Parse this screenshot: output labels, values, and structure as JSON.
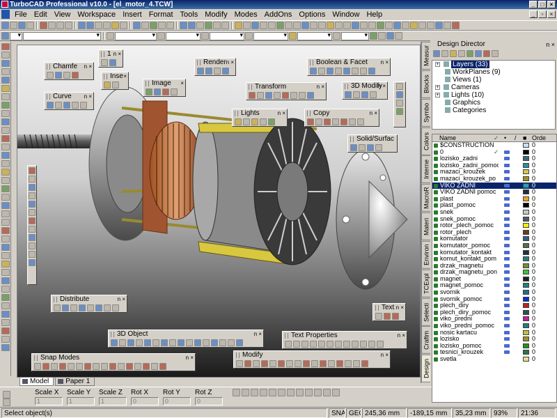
{
  "window": {
    "title": "TurboCAD Professional v10.0 - [el_motor_4.TCW]"
  },
  "menu": [
    "File",
    "Edit",
    "View",
    "Workspace",
    "Insert",
    "Format",
    "Tools",
    "Modify",
    "Modes",
    "AddOns",
    "Options",
    "Window",
    "Help"
  ],
  "palettes": {
    "chamfer": "Chamfe",
    "curve": "Curve",
    "insert": "Inse",
    "image": "Image",
    "render": "Render",
    "boolean": "Boolean & Facet",
    "transform": "Transform",
    "modify3d": "3D Modify",
    "lights": "Lights",
    "copy": "Copy",
    "solid": "Solid/Surfac",
    "distribute": "Distribute",
    "text": "Text",
    "object3d": "3D Object",
    "textprops": "Text Properties",
    "snap": "Snap Modes",
    "modify": "Modify"
  },
  "tabs": [
    "Model",
    "Paper 1"
  ],
  "inputbar": {
    "fields": [
      {
        "label": "Scale X",
        "value": "1"
      },
      {
        "label": "Scale Y",
        "value": "1"
      },
      {
        "label": "Scale Z",
        "value": "1"
      },
      {
        "label": "Rot X",
        "value": "0"
      },
      {
        "label": "Rot Y",
        "value": "0"
      },
      {
        "label": "Rot Z",
        "value": "0"
      }
    ]
  },
  "status": {
    "prompt": "Select object(s)",
    "snap": "SNAP",
    "geo": "GEO",
    "x": "245,36 mm",
    "y": "-189,15 mm",
    "z": "35,23 mm",
    "zoom": "93%",
    "time": "21:36"
  },
  "director": {
    "title": "Design Director",
    "tree": [
      {
        "label": "Layers (33)",
        "selected": true,
        "expandable": true
      },
      {
        "label": "WorkPlanes (9)",
        "selected": false,
        "expandable": false
      },
      {
        "label": "Views (1)",
        "selected": false,
        "expandable": false
      },
      {
        "label": "Cameras",
        "selected": false,
        "expandable": true
      },
      {
        "label": "Lights (10)",
        "selected": false,
        "expandable": true
      },
      {
        "label": "Graphics",
        "selected": false,
        "expandable": false
      },
      {
        "label": "Categories",
        "selected": false,
        "expandable": false
      }
    ],
    "columns": [
      "Name",
      "Orde"
    ],
    "layers": [
      {
        "name": "$CONSTRUCTION",
        "order": "0",
        "color": "#c8e0f0",
        "print": false,
        "check": false
      },
      {
        "name": "0",
        "order": "0",
        "color": "#000000",
        "print": true,
        "check": true
      },
      {
        "name": "lozisko_zadni",
        "order": "0",
        "color": "#3a6a7a",
        "print": true,
        "check": false
      },
      {
        "name": "lozisko_zadni_pomoc",
        "order": "0",
        "color": "#2f8fa0",
        "print": true,
        "check": false
      },
      {
        "name": "mazaci_kroužek",
        "order": "0",
        "color": "#d0c850",
        "print": true,
        "check": false
      },
      {
        "name": "mazaci_krouzek_po",
        "order": "0",
        "color": "#a09020",
        "print": true,
        "check": false
      },
      {
        "name": "VIKO ZADNI",
        "order": "0",
        "color": "#20a0c0",
        "print": true,
        "check": false
      },
      {
        "name": "VIKO ZADNI pomoc",
        "order": "0",
        "color": "#203040",
        "print": true,
        "check": false
      },
      {
        "name": "plast",
        "order": "0",
        "color": "#f0a020",
        "print": true,
        "check": false
      },
      {
        "name": "plast_pomoc",
        "order": "0",
        "color": "#000000",
        "print": true,
        "check": false
      },
      {
        "name": "snek",
        "order": "0",
        "color": "#c8c8c8",
        "print": true,
        "check": false
      },
      {
        "name": "snek_pomoc",
        "order": "0",
        "color": "#4a5a6a",
        "print": true,
        "check": false
      },
      {
        "name": "rotor_plech_pomoc",
        "order": "0",
        "color": "#f0f000",
        "print": true,
        "check": false
      },
      {
        "name": "rotor_plech",
        "order": "0",
        "color": "#6a3a20",
        "print": true,
        "check": false
      },
      {
        "name": "komutator",
        "order": "0",
        "color": "#306080",
        "print": true,
        "check": false
      },
      {
        "name": "komutator_pomoc",
        "order": "0",
        "color": "#507050",
        "print": true,
        "check": false
      },
      {
        "name": "komutator_kontakt",
        "order": "0",
        "color": "#203040",
        "print": true,
        "check": false
      },
      {
        "name": "komut_kontakt_pom",
        "order": "0",
        "color": "#2a7a7a",
        "print": true,
        "check": false
      },
      {
        "name": "drzak_magnetu",
        "order": "0",
        "color": "#7a8a30",
        "print": true,
        "check": false
      },
      {
        "name": "drzak_magnetu_pon",
        "order": "0",
        "color": "#40c040",
        "print": true,
        "check": false
      },
      {
        "name": "magnet",
        "order": "0",
        "color": "#202020",
        "print": true,
        "check": false
      },
      {
        "name": "magnet_pomoc",
        "order": "0",
        "color": "#208080",
        "print": true,
        "check": false
      },
      {
        "name": "svornik",
        "order": "0",
        "color": "#2a6a8a",
        "print": true,
        "check": false
      },
      {
        "name": "svornik_pomoc",
        "order": "0",
        "color": "#0030d0",
        "print": true,
        "check": false
      },
      {
        "name": "plech_diry",
        "order": "0",
        "color": "#c02020",
        "print": true,
        "check": false
      },
      {
        "name": "plech_diry_pomoc",
        "order": "0",
        "color": "#305050",
        "print": true,
        "check": false
      },
      {
        "name": "viko_predni",
        "order": "0",
        "color": "#c02090",
        "print": true,
        "check": false
      },
      {
        "name": "viko_predni_pomoc",
        "order": "0",
        "color": "#208080",
        "print": true,
        "check": false
      },
      {
        "name": "nosic kartacu",
        "order": "0",
        "color": "#c0c040",
        "print": true,
        "check": false
      },
      {
        "name": "lozisko",
        "order": "0",
        "color": "#a09020",
        "print": true,
        "check": false
      },
      {
        "name": "lozisko_pomoc",
        "order": "0",
        "color": "#209020",
        "print": true,
        "check": false
      },
      {
        "name": "tesnici_krouzek",
        "order": "0",
        "color": "#307050",
        "print": true,
        "check": false
      },
      {
        "name": "svetla",
        "order": "0",
        "color": "#e0e090",
        "print": false,
        "check": false
      }
    ],
    "selectedLayer": 6,
    "sideTabs": [
      "Measur",
      "Blocks",
      "Symbo",
      "Colors",
      "Interne",
      "MacroR",
      "Materi",
      "Environ",
      "TCExpl",
      "Selecti",
      "Craftm",
      "Design"
    ]
  }
}
